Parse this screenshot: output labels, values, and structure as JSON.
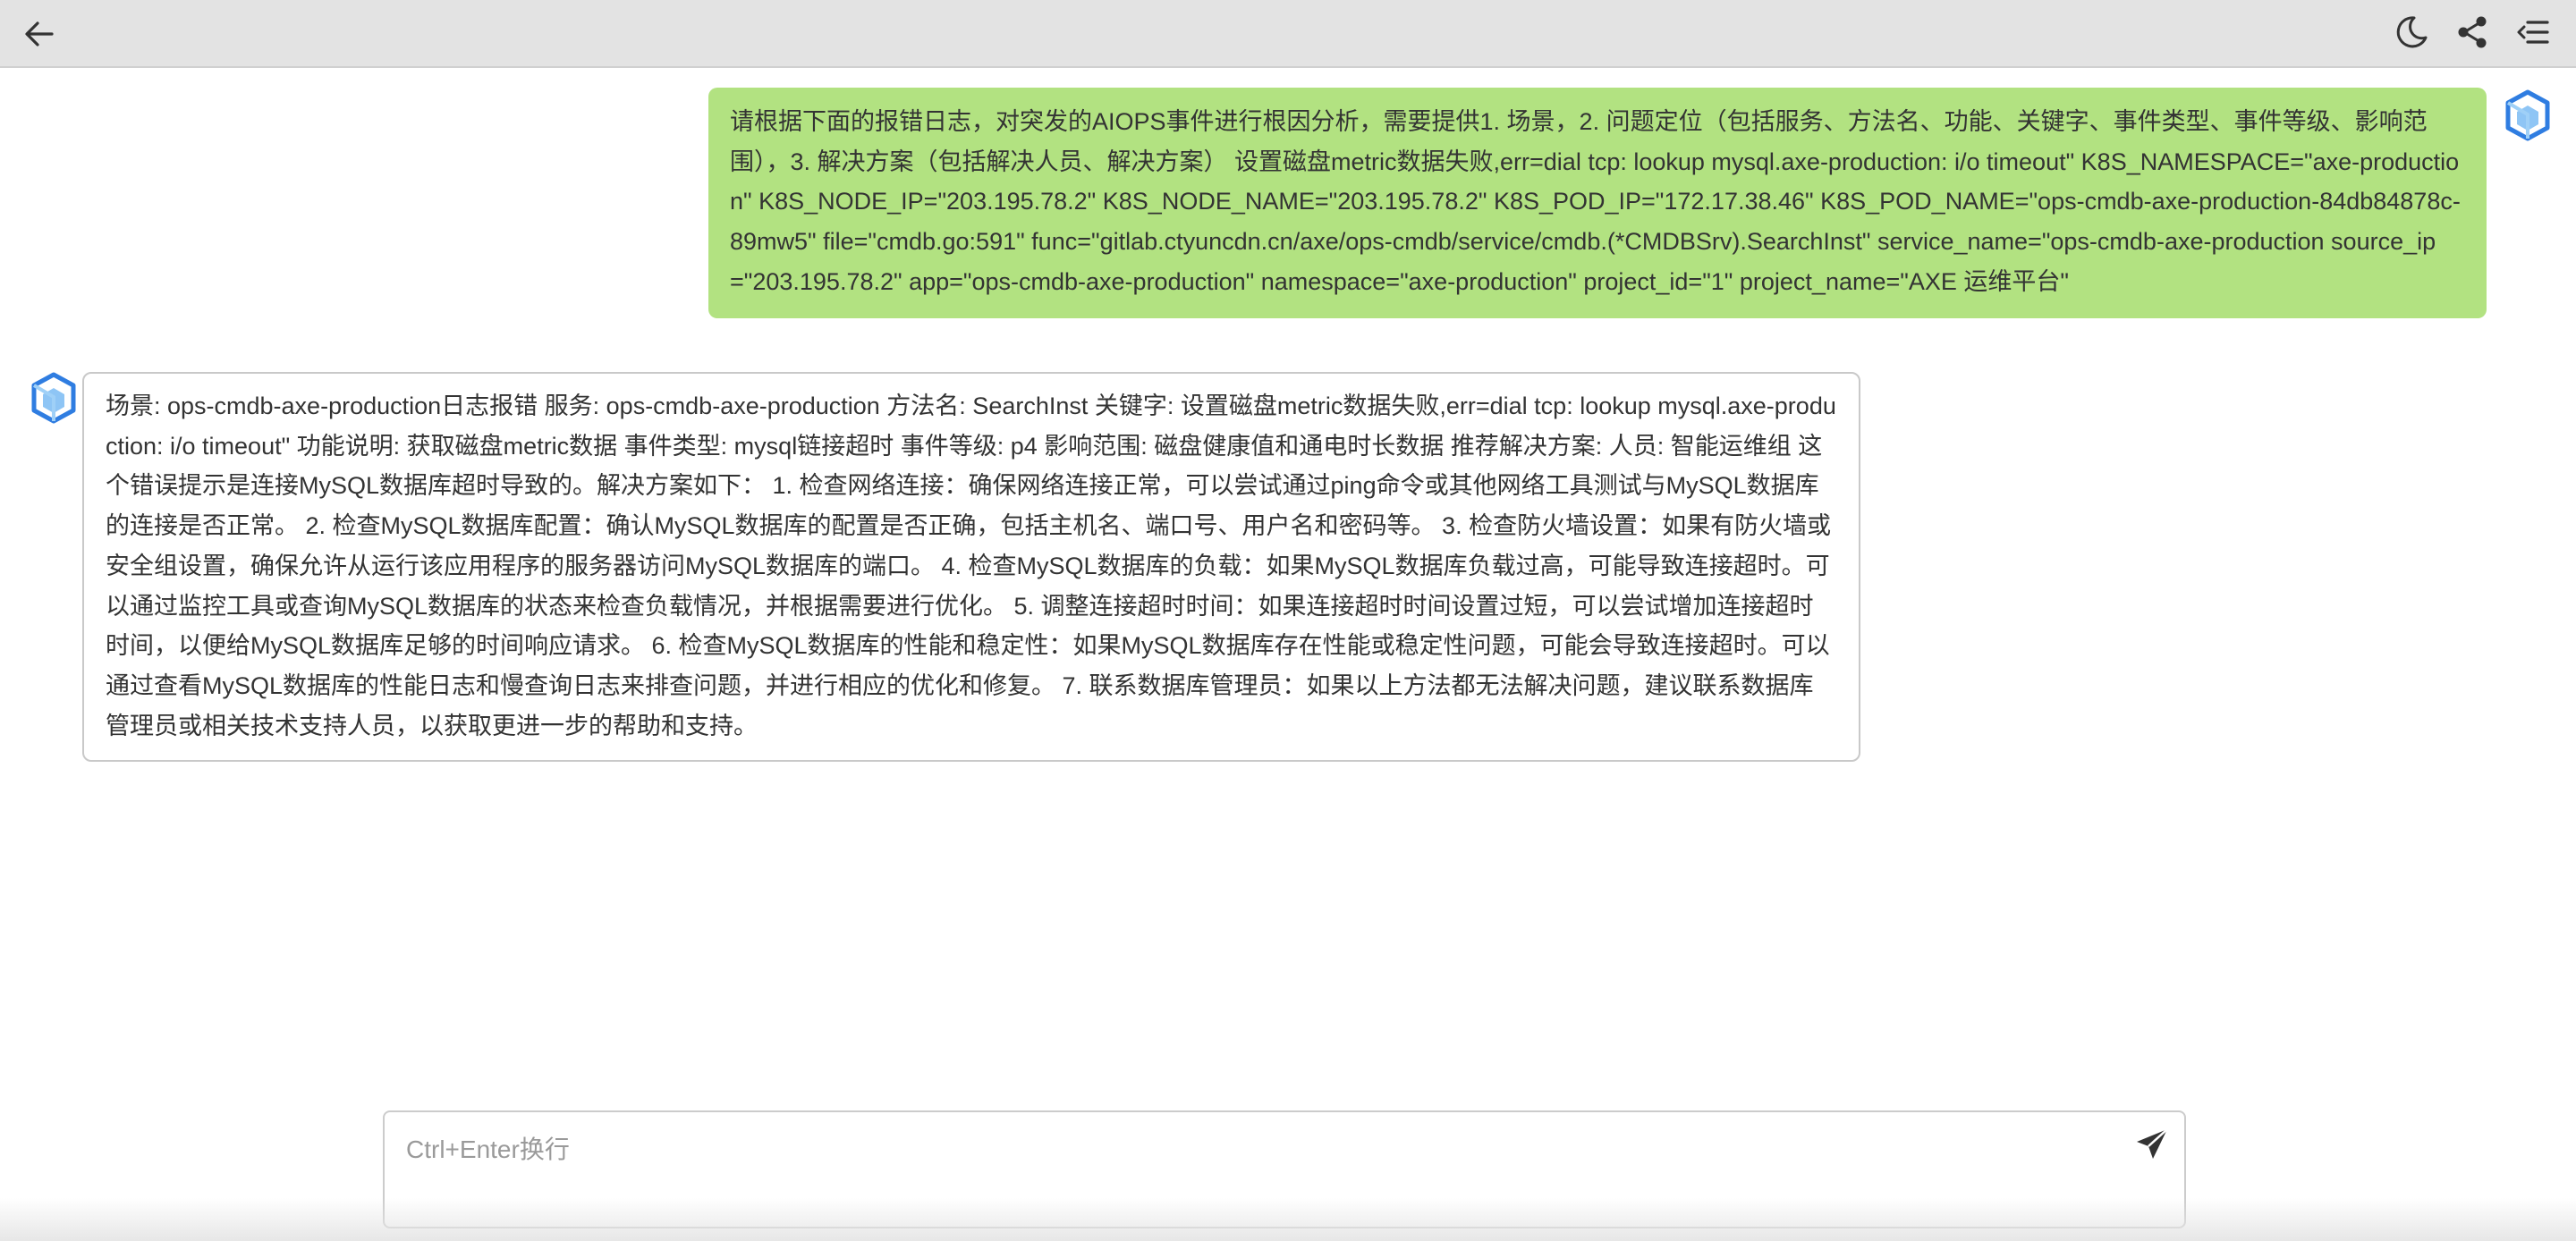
{
  "header": {
    "icons": {
      "back": "arrow-left-icon",
      "theme": "moon-icon",
      "share": "share-icon",
      "menu": "menu-icon"
    }
  },
  "messages": [
    {
      "role": "user",
      "avatar_icon": "bot-logo-icon",
      "text": "请根据下面的报错日志，对突发的AIOPS事件进行根因分析，需要提供1. 场景，2. 问题定位（包括服务、方法名、功能、关键字、事件类型、事件等级、影响范围），3. 解决方案（包括解决人员、解决方案） 设置磁盘metric数据失败,err=dial tcp: lookup mysql.axe-production: i/o timeout\" K8S_NAMESPACE=\"axe-production\" K8S_NODE_IP=\"203.195.78.2\" K8S_NODE_NAME=\"203.195.78.2\" K8S_POD_IP=\"172.17.38.46\" K8S_POD_NAME=\"ops-cmdb-axe-production-84db84878c-89mw5\" file=\"cmdb.go:591\" func=\"gitlab.ctyuncdn.cn/axe/ops-cmdb/service/cmdb.(*CMDBSrv).SearchInst\" service_name=\"ops-cmdb-axe-production source_ip=\"203.195.78.2\" app=\"ops-cmdb-axe-production\" namespace=\"axe-production\" project_id=\"1\" project_name=\"AXE 运维平台\""
    },
    {
      "role": "assistant",
      "avatar_icon": "bot-logo-icon",
      "text": "场景: ops-cmdb-axe-production日志报错 服务: ops-cmdb-axe-production 方法名: SearchInst 关键字: 设置磁盘metric数据失败,err=dial tcp: lookup mysql.axe-production: i/o timeout\"  功能说明: 获取磁盘metric数据 事件类型: mysql链接超时 事件等级: p4 影响范围: 磁盘健康值和通电时长数据 推荐解决方案: 人员: 智能运维组 这个错误提示是连接MySQL数据库超时导致的。解决方案如下：  1. 检查网络连接：确保网络连接正常，可以尝试通过ping命令或其他网络工具测试与MySQL数据库的连接是否正常。 2. 检查MySQL数据库配置：确认MySQL数据库的配置是否正确，包括主机名、端口号、用户名和密码等。 3. 检查防火墙设置：如果有防火墙或安全组设置，确保允许从运行该应用程序的服务器访问MySQL数据库的端口。 4. 检查MySQL数据库的负载：如果MySQL数据库负载过高，可能导致连接超时。可以通过监控工具或查询MySQL数据库的状态来检查负载情况，并根据需要进行优化。 5. 调整连接超时时间：如果连接超时时间设置过短，可以尝试增加连接超时时间，以便给MySQL数据库足够的时间响应请求。 6. 检查MySQL数据库的性能和稳定性：如果MySQL数据库存在性能或稳定性问题，可能会导致连接超时。可以通过查看MySQL数据库的性能日志和慢查询日志来排查问题，并进行相应的优化和修复。 7. 联系数据库管理员：如果以上方法都无法解决问题，建议联系数据库管理员或相关技术支持人员，以获取更进一步的帮助和支持。"
    }
  ],
  "composer": {
    "placeholder": "Ctrl+Enter换行",
    "value": "",
    "send_icon": "send-icon"
  },
  "colors": {
    "topbar_bg": "#e3e3e3",
    "user_bubble": "#b2e281",
    "assistant_border": "#c9c9c9",
    "text": "#333333",
    "logo_blue": "#2f7de1"
  }
}
